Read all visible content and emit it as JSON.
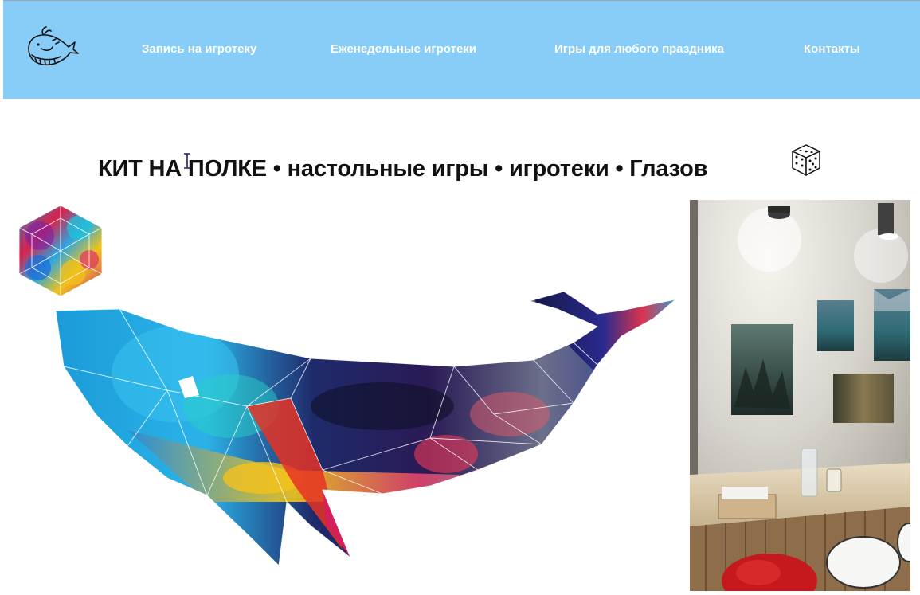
{
  "header": {
    "background_color": "#87cdf7",
    "logo_icon": "whale-logo-icon",
    "nav": [
      {
        "label": "Запись на игротеку"
      },
      {
        "label": "Еженедельные игротеки"
      },
      {
        "label": "Игры для любого праздника"
      },
      {
        "label": "Контакты"
      }
    ]
  },
  "main": {
    "headline": "КИТ НА ПОЛКЕ • настольные игры • игротеки • Глазов",
    "headline_icon": "dice-icon",
    "hero_icon": "watercolor-hexagon-icon",
    "hero_image": "watercolor-geometric-whale",
    "photo": "game-room-interior-photo"
  }
}
